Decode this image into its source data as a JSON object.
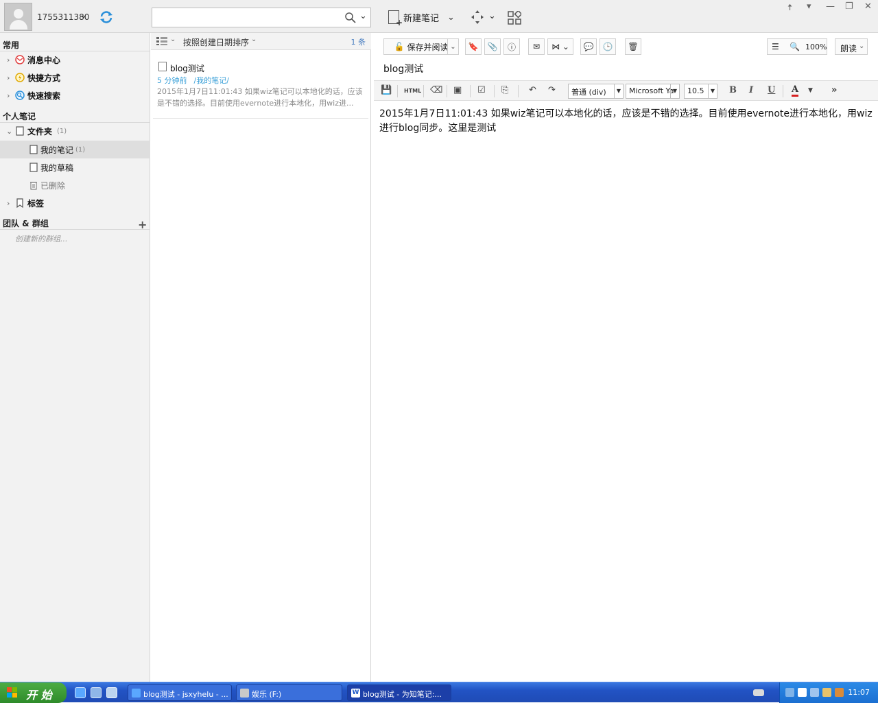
{
  "topbar": {
    "user_id": "1755311380",
    "search_placeholder": "",
    "new_note_label": "新建笔记"
  },
  "sidebar": {
    "common_title": "常用",
    "common_items": [
      {
        "label": "消息中心",
        "icon": "message-center-icon"
      },
      {
        "label": "快捷方式",
        "icon": "shortcut-icon"
      },
      {
        "label": "快速搜索",
        "icon": "quick-search-icon"
      }
    ],
    "personal_title": "个人笔记",
    "folder_root": {
      "label": "文件夹",
      "count": "(1)"
    },
    "folders": [
      {
        "label": "我的笔记",
        "count": "(1)"
      },
      {
        "label": "我的草稿",
        "count": ""
      },
      {
        "label": "已删除",
        "count": ""
      }
    ],
    "tags_label": "标签",
    "team_title": "团队 & 群组",
    "create_group": "创建新的群组..."
  },
  "notelist": {
    "sort_label": "按照创建日期排序",
    "count": "1 条",
    "notes": [
      {
        "title": "blog测试",
        "time": "5 分钟前",
        "path": "/我的笔记/",
        "snippet": "2015年1月7日11:01:43 如果wiz笔记可以本地化的话，应该是不错的选择。目前使用evernote进行本地化，用wiz进..."
      }
    ]
  },
  "editor": {
    "save_read_label": "保存并阅读",
    "zoom": "100%",
    "read_aloud": "朗读",
    "doc_title": "blog测试",
    "paragraph_style": "普通 (div)",
    "font_name": "Microsoft Ya",
    "font_size": "10.5",
    "html_label": "HTML",
    "bold": "B",
    "italic": "I",
    "underline": "U",
    "font_color_letter": "A",
    "more": "»",
    "content": "2015年1月7日11:01:43 如果wiz笔记可以本地化的话，应该是不错的选择。目前使用evernote进行本地化，用wiz进行blog同步。这里是测试"
  },
  "taskbar": {
    "start_label": "开 始",
    "tasks": [
      {
        "label": "blog测试 - jsxyhelu - ..."
      },
      {
        "label": "娱乐 (F:)"
      },
      {
        "label": "blog测试 - 为知笔记:..."
      }
    ],
    "clock": "11:07"
  },
  "colors": {
    "accent_blue": "#3aa0d8",
    "taskbar_blue": "#2253c4",
    "start_green": "#3a9d36",
    "font_color_red": "#d62020"
  }
}
